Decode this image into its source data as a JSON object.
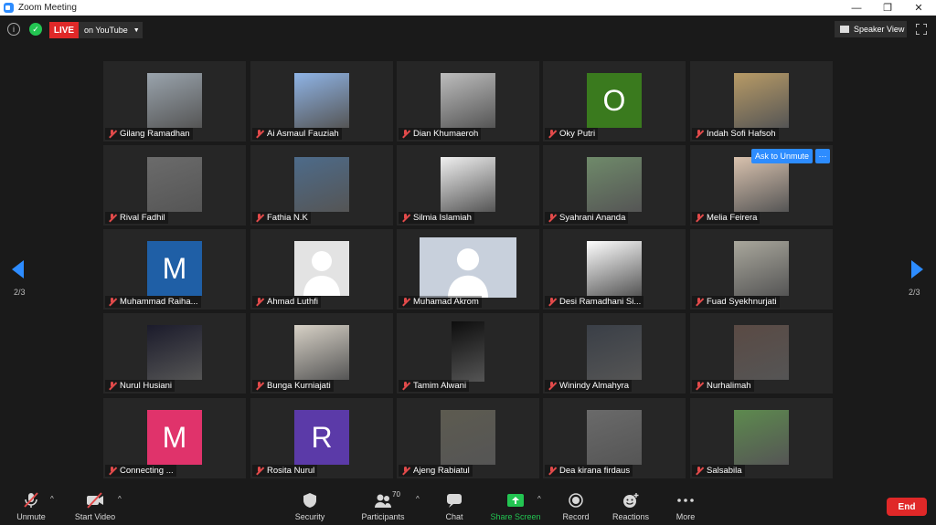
{
  "window": {
    "title": "Zoom Meeting"
  },
  "topbar": {
    "live_label": "LIVE",
    "live_destination": "on YouTube",
    "view_label": "Speaker View"
  },
  "navigation": {
    "page_indicator_left": "2/3",
    "page_indicator_right": "2/3"
  },
  "hover_actions": {
    "ask_unmute": "Ask to Unmute",
    "more": "···"
  },
  "participants": [
    {
      "name": "Gilang Ramadhan",
      "thumb": "photo",
      "color": "#9aa4ad"
    },
    {
      "name": "Ai Asmaul Fauziah",
      "thumb": "photo",
      "color": "#8fb4e6"
    },
    {
      "name": "Dian Khumaeroh",
      "thumb": "photo",
      "color": "#bdbdbd"
    },
    {
      "name": "Oky Putri",
      "thumb": "initial",
      "initial": "O",
      "color": "#3a7a1e"
    },
    {
      "name": "Indah Sofi Hafsoh",
      "thumb": "photo",
      "color": "#b89b66"
    },
    {
      "name": "Rival Fadhil",
      "thumb": "photo",
      "color": "#6b6b6b"
    },
    {
      "name": "Fathia N.K",
      "thumb": "photo",
      "color": "#4d6b8a"
    },
    {
      "name": "Silmia Islamiah",
      "thumb": "photo",
      "color": "#efefef"
    },
    {
      "name": "Syahrani Ananda",
      "thumb": "photo",
      "color": "#6f8a6a"
    },
    {
      "name": "Melia Feirera",
      "thumb": "photo",
      "color": "#d9c2ae"
    },
    {
      "name": "Muhammad Raiha...",
      "thumb": "initial",
      "initial": "M",
      "color": "#1f5fa6"
    },
    {
      "name": "Ahmad Luthfi",
      "thumb": "avatar",
      "color": "#e3e3e3"
    },
    {
      "name": "Muhamad Akrom",
      "thumb": "avatar-wide",
      "color": "#c8d0dc"
    },
    {
      "name": "Desi Ramadhani Si...",
      "thumb": "photo",
      "color": "#ffffff"
    },
    {
      "name": "Fuad Syekhnurjati",
      "thumb": "photo",
      "color": "#a9a79c"
    },
    {
      "name": "Nurul Husiani",
      "thumb": "photo",
      "color": "#1b1b2b"
    },
    {
      "name": "Bunga Kurniajati",
      "thumb": "photo",
      "color": "#d7d1c6"
    },
    {
      "name": "Tamim Alwani",
      "thumb": "photo-narrow",
      "color": "#0d0d0d"
    },
    {
      "name": "Winindy Almahyra",
      "thumb": "photo",
      "color": "#3a3f47"
    },
    {
      "name": "Nurhalimah",
      "thumb": "photo",
      "color": "#5a4a44"
    },
    {
      "name": "Connecting ...",
      "thumb": "initial",
      "initial": "M",
      "color": "#e0336b"
    },
    {
      "name": "Rosita Nurul",
      "thumb": "initial",
      "initial": "R",
      "color": "#5b3aa8"
    },
    {
      "name": "Ajeng Rabiatul",
      "thumb": "photo",
      "color": "#5d5b50"
    },
    {
      "name": "Dea kirana firdaus",
      "thumb": "photo",
      "color": "#6a6a6a"
    },
    {
      "name": "Salsabila",
      "thumb": "photo",
      "color": "#5d8a4e"
    }
  ],
  "toolbar": {
    "unmute": "Unmute",
    "start_video": "Start Video",
    "security": "Security",
    "participants": "Participants",
    "participants_count": "70",
    "chat": "Chat",
    "share_screen": "Share Screen",
    "record": "Record",
    "reactions": "Reactions",
    "more": "More",
    "end": "End"
  },
  "colors": {
    "accent": "#2d8cff",
    "live": "#e02828",
    "share": "#23c552",
    "muted": "#e24a4a"
  }
}
